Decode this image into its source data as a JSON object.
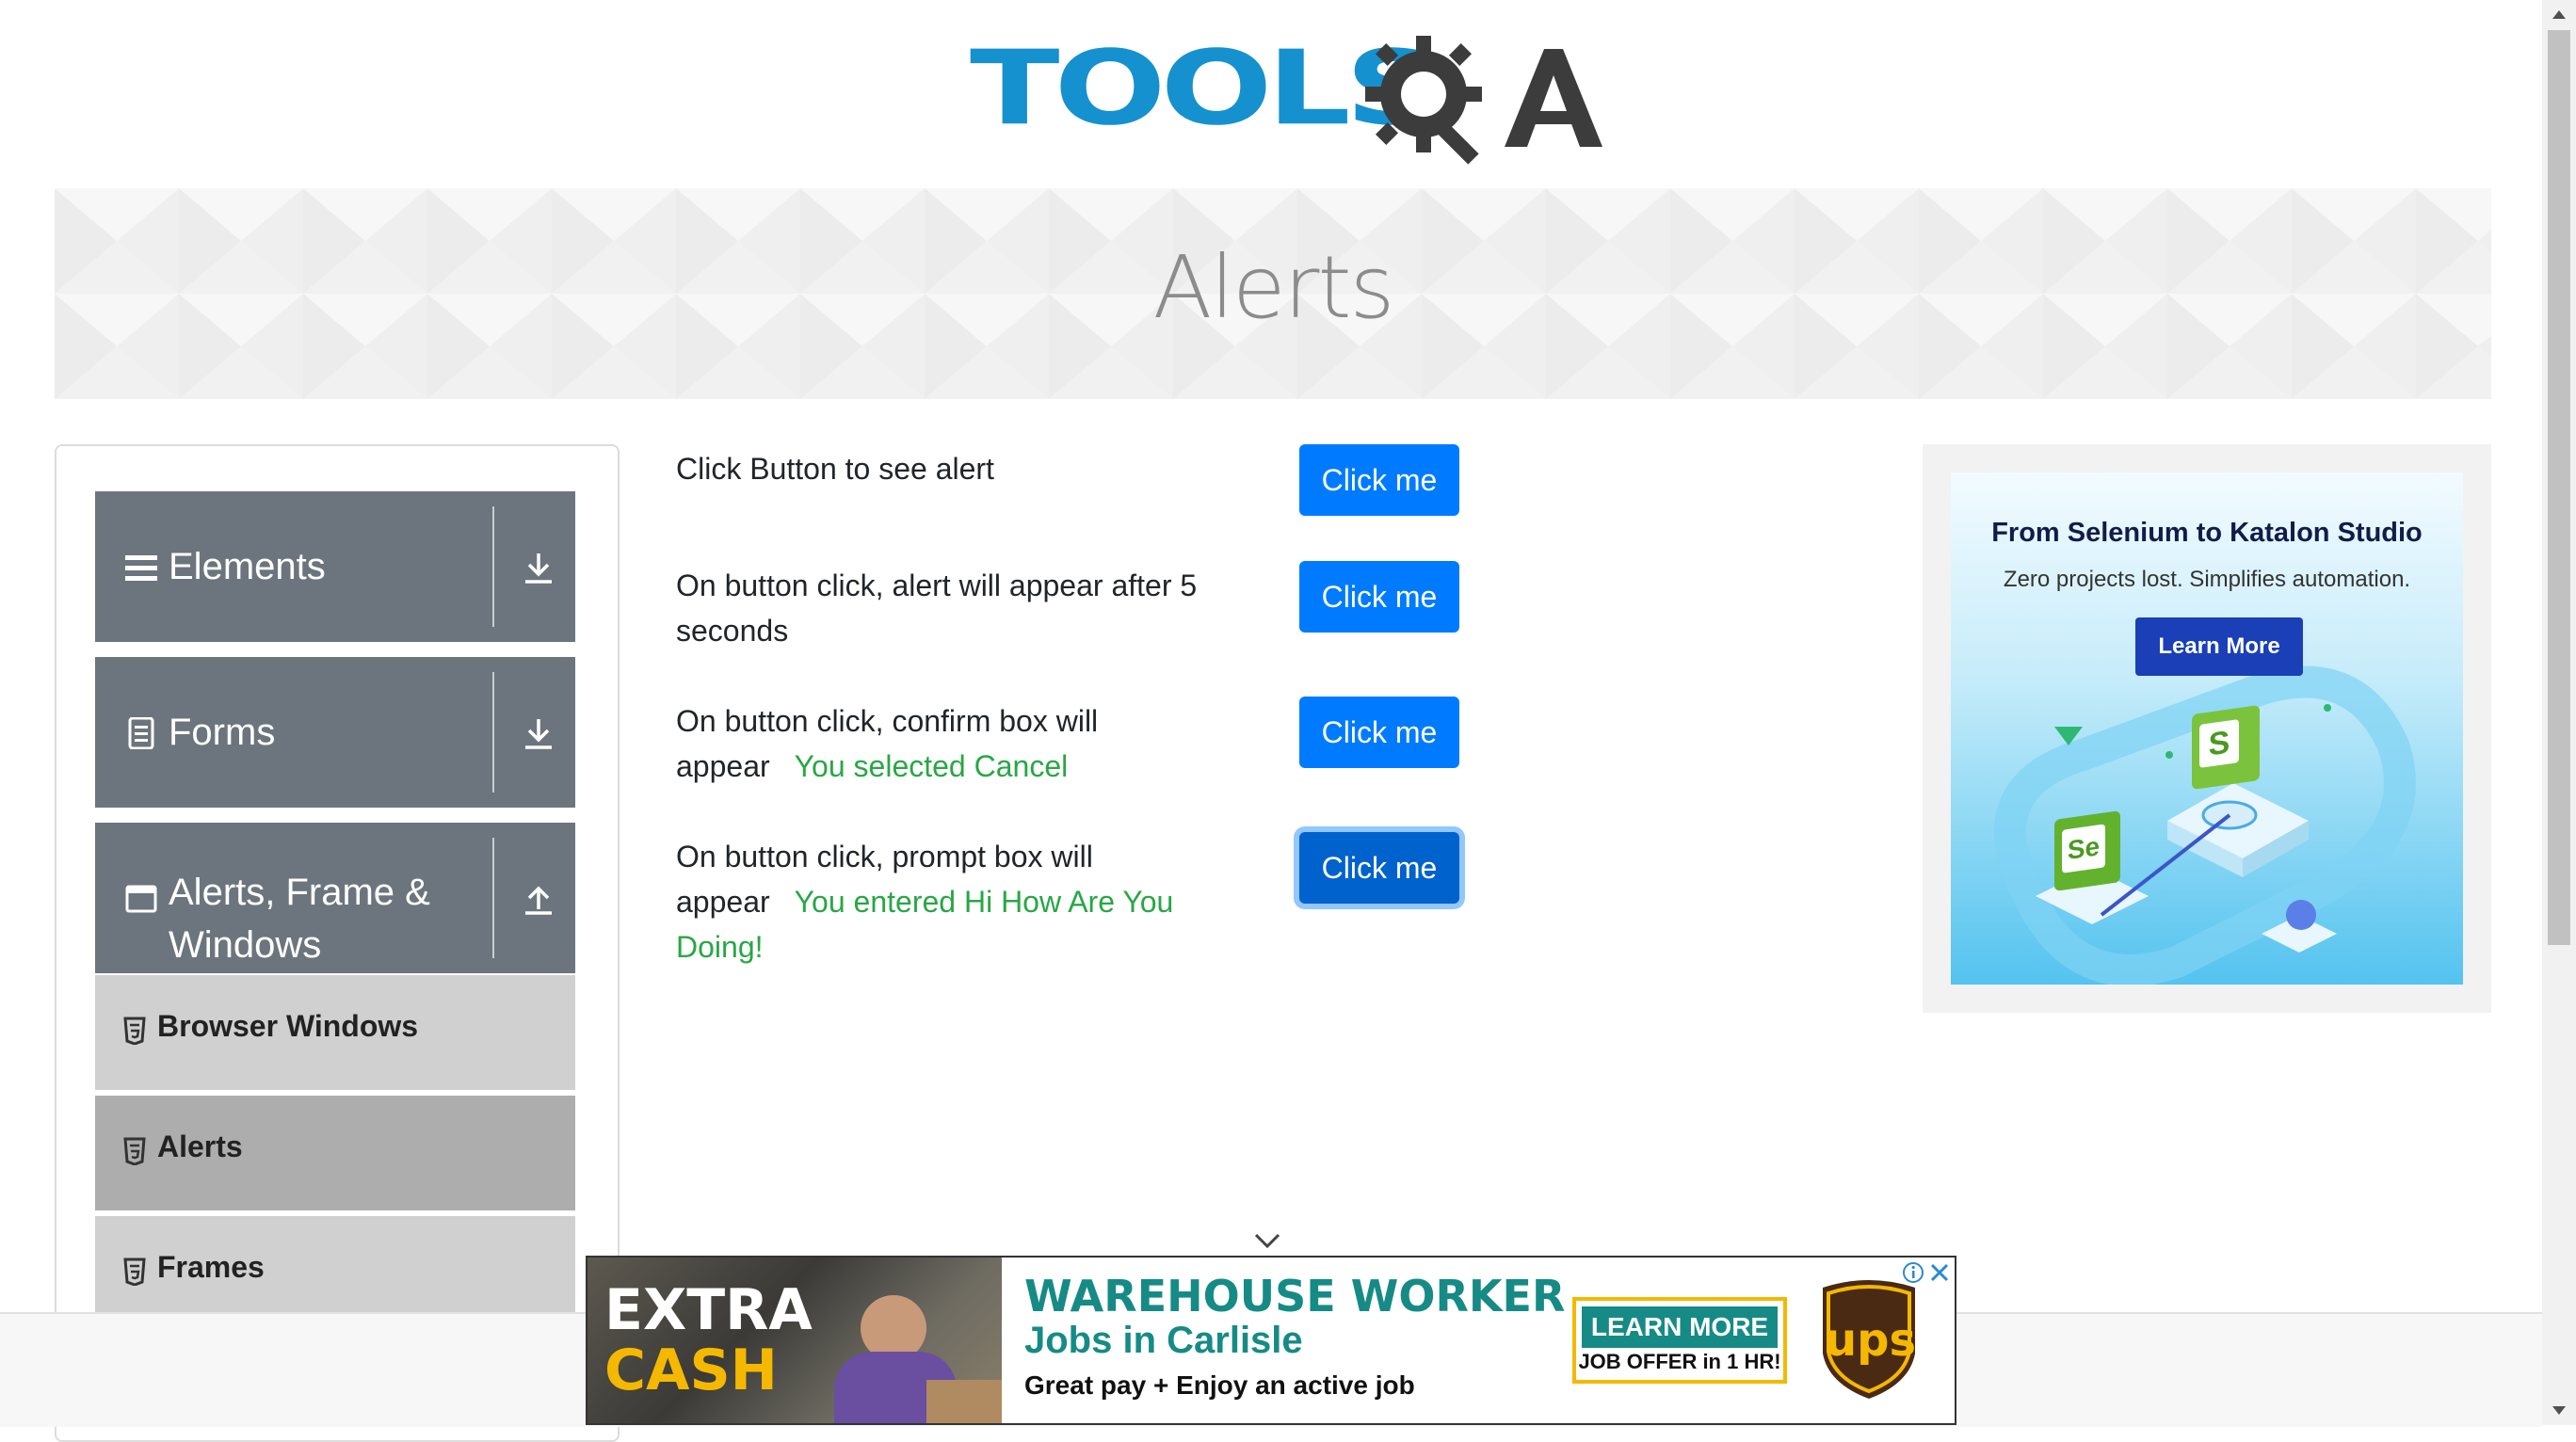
{
  "logo": {
    "text": "TOOLSQA",
    "left_text": "TOOLS",
    "right_text": "A"
  },
  "banner": {
    "title": "Alerts"
  },
  "sidebar": {
    "groups": [
      {
        "label": "Elements",
        "icon": "menu-icon",
        "arrow": "download-icon"
      },
      {
        "label": "Forms",
        "icon": "document-icon",
        "arrow": "download-icon"
      },
      {
        "label_line1": "Alerts, Frame &",
        "label_line2": "Windows",
        "icon": "window-icon",
        "arrow": "upload-icon"
      }
    ],
    "items": [
      {
        "label": "Browser Windows",
        "active": false
      },
      {
        "label": "Alerts",
        "active": true
      },
      {
        "label": "Frames",
        "active": false
      }
    ]
  },
  "main": {
    "rows": [
      {
        "text": "Click Button to see alert",
        "result": "",
        "button": "Click me"
      },
      {
        "text_line1": "On button click, alert will appear after 5",
        "text_line2": "seconds",
        "result": "",
        "button": "Click me"
      },
      {
        "text_line1": "On button click, confirm box will",
        "text_line2": "appear",
        "result": "You selected Cancel",
        "button": "Click me"
      },
      {
        "text_line1": "On button click, prompt box will",
        "text_line2": "appear",
        "result_line1": "You entered Hi How Are You",
        "result_line2": "Doing!",
        "button": "Click me"
      }
    ],
    "colors": {
      "button": "#007bff",
      "result": "#28a745"
    }
  },
  "right_ad": {
    "headline": "From Selenium to Katalon Studio",
    "subline": "Zero projects lost. Simplifies automation.",
    "button": "Learn More",
    "badge_s": "S",
    "badge_se": "Se"
  },
  "bottom_ad": {
    "extra": "EXTRA",
    "cash": "CASH",
    "headline": "WAREHOUSE WORKER",
    "subhead": "Jobs in Carlisle",
    "tagline": "Great pay + Enjoy an active job",
    "cta": "LEARN MORE",
    "offer": "JOB OFFER in 1 HR!",
    "brand": "ups"
  }
}
